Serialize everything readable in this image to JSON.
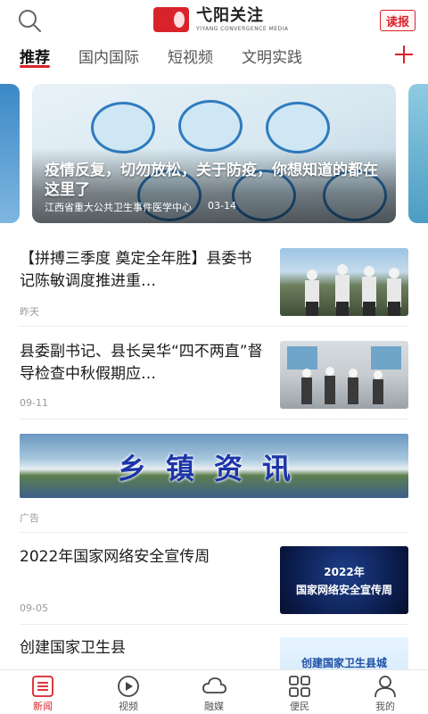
{
  "header": {
    "logo_cn": "弋阳关注",
    "logo_en": "YIYANG CONVERGENCE MEDIA",
    "read_label": "读报"
  },
  "tabs": [
    {
      "label": "推荐",
      "active": true
    },
    {
      "label": "国内国际",
      "active": false
    },
    {
      "label": "短视频",
      "active": false
    },
    {
      "label": "文明实践",
      "active": false
    }
  ],
  "carousel": {
    "title": "疫情反复，切勿放松，关于防疫，你想知道的都在这里了",
    "source": "江西省重大公共卫生事件医学中心",
    "date": "03-14"
  },
  "news": [
    {
      "title": "【拼搏三季度 奠定全年胜】县委书记陈敏调度推进重…",
      "time": "昨天"
    },
    {
      "title": "县委副书记、县长吴华“四不两直”督导检查中秋假期应…",
      "time": "09-11"
    },
    {
      "title": "2022年国家网络安全宣传周",
      "time": "09-05",
      "thumb_text_top": "2022年",
      "thumb_text_bottom": "国家网络安全宣传周"
    },
    {
      "title": "创建国家卫生县",
      "thumb_text": "创建国家卫生县城"
    }
  ],
  "ad": {
    "banner_text": "乡镇资讯",
    "label": "广告"
  },
  "bottom_nav": [
    {
      "label": "新闻",
      "icon": "news-list-icon",
      "active": true
    },
    {
      "label": "视频",
      "icon": "play-icon",
      "active": false
    },
    {
      "label": "融媒",
      "icon": "cloud-icon",
      "active": false
    },
    {
      "label": "便民",
      "icon": "grid-icon",
      "active": false
    },
    {
      "label": "我的",
      "icon": "user-icon",
      "active": false
    }
  ],
  "colors": {
    "accent": "#d9232b",
    "text": "#1a1a1a",
    "meta": "#999999"
  }
}
